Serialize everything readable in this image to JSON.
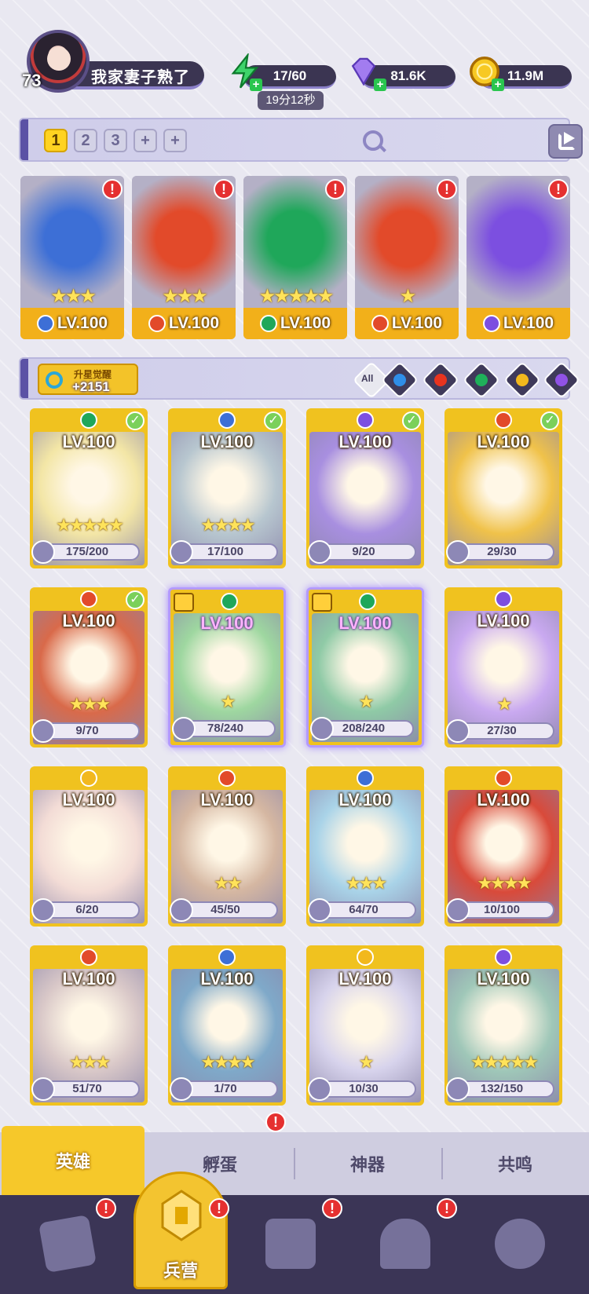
{
  "player": {
    "level": "73",
    "name": "我家妻子熟了"
  },
  "resources": {
    "energy": "17/60",
    "energy_timer": "19分12秒",
    "gems": "81.6K",
    "gold": "11.9M"
  },
  "team_tabs": [
    "1",
    "2",
    "3",
    "+",
    "+"
  ],
  "team": [
    {
      "element": "water",
      "stars": "★★★",
      "level": "LV.100",
      "color": "#3d6fd6"
    },
    {
      "element": "fire",
      "stars": "★★★",
      "level": "LV.100",
      "color": "#e24a2a"
    },
    {
      "element": "wind",
      "stars": "★★★★★",
      "level": "LV.100",
      "color": "#1fa75a"
    },
    {
      "element": "fire",
      "stars": "★",
      "level": "LV.100",
      "color": "#e24a2a"
    },
    {
      "element": "dark",
      "stars": "",
      "level": "LV.100",
      "color": "#7c4fe0"
    }
  ],
  "awaken": {
    "title": "升星觉醒",
    "count": "+2151"
  },
  "filters": {
    "all_label": "All",
    "elements": [
      {
        "name": "water-filter-icon",
        "color": "#2f8ee8"
      },
      {
        "name": "fire-filter-icon",
        "color": "#e8341f"
      },
      {
        "name": "wind-filter-icon",
        "color": "#1fb05a"
      },
      {
        "name": "light-filter-icon",
        "color": "#f2b81d"
      },
      {
        "name": "dark-filter-icon",
        "color": "#9052e6"
      }
    ]
  },
  "heroes": [
    {
      "level": "LV.100",
      "shards": "175/200",
      "stars": "★★★★★",
      "element_color": "#1fa75a",
      "checked": true,
      "art": "#f3e6a6"
    },
    {
      "level": "LV.100",
      "shards": "17/100",
      "stars": "★★★★",
      "element_color": "#3d6fd6",
      "checked": true,
      "art": "#b7c6cf"
    },
    {
      "level": "LV.100",
      "shards": "9/20",
      "stars": "",
      "element_color": "#7c4fe0",
      "checked": true,
      "art": "#a88fe0"
    },
    {
      "level": "LV.100",
      "shards": "29/30",
      "stars": "",
      "element_color": "#e24a2a",
      "checked": true,
      "art": "#f0c24a"
    },
    {
      "level": "LV.100",
      "shards": "9/70",
      "stars": "★★★",
      "element_color": "#e24a2a",
      "checked": true,
      "art": "#d96a4a"
    },
    {
      "level": "LV.100",
      "shards": "78/240",
      "stars": "★",
      "element_color": "#1fa75a",
      "special": true,
      "art": "#9ed7a0"
    },
    {
      "level": "LV.100",
      "shards": "208/240",
      "stars": "★",
      "element_color": "#1fa75a",
      "special": true,
      "art": "#8fcaa6"
    },
    {
      "level": "LV.100",
      "shards": "27/30",
      "stars": "★",
      "element_color": "#7c4fe0",
      "art": "#c9a9f0"
    },
    {
      "level": "LV.100",
      "shards": "6/20",
      "stars": "",
      "element_color": "#f2b81d",
      "art": "#f3dcd6"
    },
    {
      "level": "LV.100",
      "shards": "45/50",
      "stars": "★★",
      "element_color": "#e24a2a",
      "art": "#d5b7a2"
    },
    {
      "level": "LV.100",
      "shards": "64/70",
      "stars": "★★★",
      "element_color": "#3d6fd6",
      "art": "#a9d3e8"
    },
    {
      "level": "LV.100",
      "shards": "10/100",
      "stars": "★★★★",
      "element_color": "#e24a2a",
      "art": "#d94a3a"
    },
    {
      "level": "LV.100",
      "shards": "51/70",
      "stars": "★★★",
      "element_color": "#e24a2a",
      "art": "#d9c8c8"
    },
    {
      "level": "LV.100",
      "shards": "1/70",
      "stars": "★★★★",
      "element_color": "#3d6fd6",
      "art": "#7fa9c9"
    },
    {
      "level": "LV.100",
      "shards": "10/30",
      "stars": "★",
      "element_color": "#f2b81d",
      "art": "#d7d3ec"
    },
    {
      "level": "LV.100",
      "shards": "132/150",
      "stars": "★★★★★",
      "element_color": "#7c4fe0",
      "art": "#9fc7b8"
    }
  ],
  "sub_tabs": [
    "英雄",
    "孵蛋",
    "神器",
    "共鸣"
  ],
  "nav": {
    "active_label": "兵营"
  }
}
